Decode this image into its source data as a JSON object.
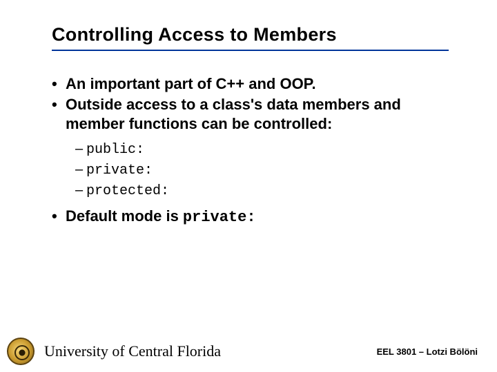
{
  "title": "Controlling Access to Members",
  "bullets": {
    "b1": "An important part of C++ and OOP.",
    "b2": "Outside access to a class's data members and member functions can be controlled:",
    "sub": {
      "s1": "public:",
      "s2": "private:",
      "s3": "protected:"
    },
    "b3_pre": "Default mode is ",
    "b3_code": "private:"
  },
  "footer": {
    "university": "University of Central Florida",
    "course": "EEL 3801 – Lotzi Bölöni"
  }
}
